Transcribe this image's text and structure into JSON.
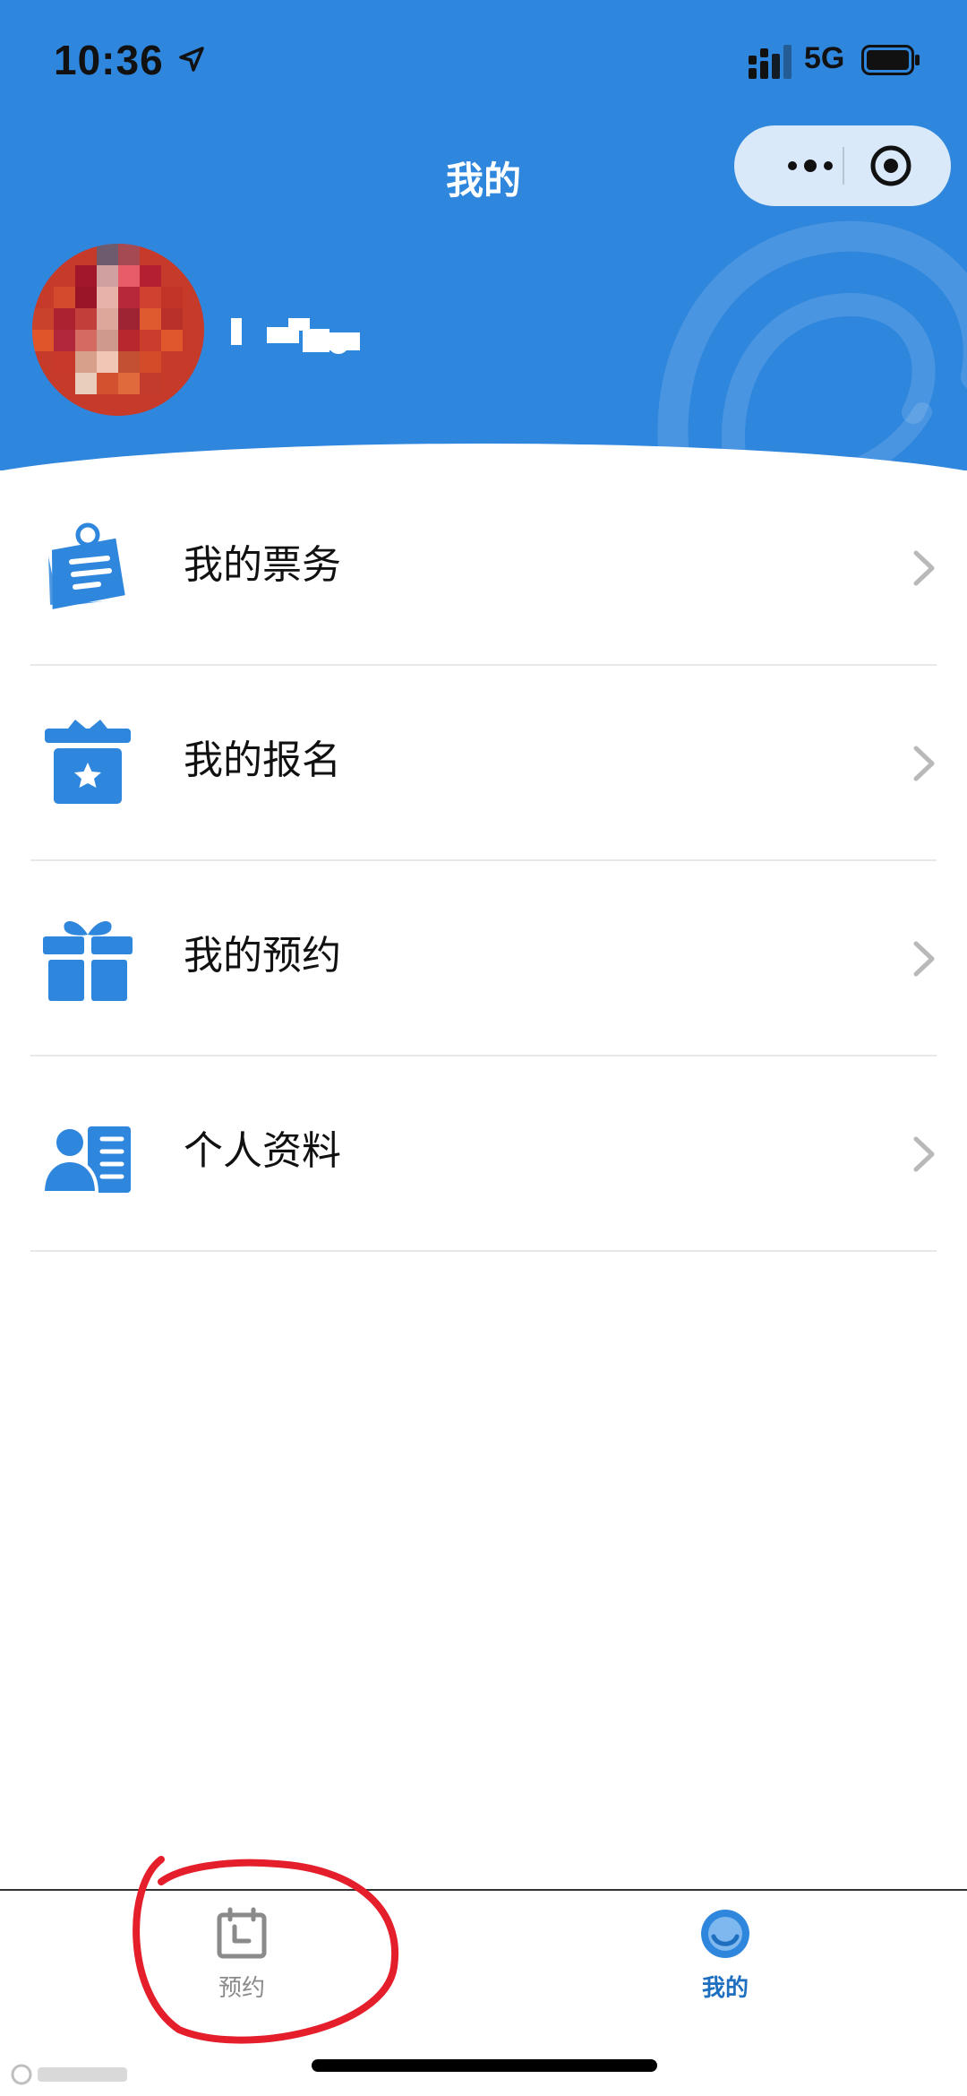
{
  "status_bar": {
    "time": "10:36",
    "network": "5G",
    "location_icon": "location-arrow-icon",
    "signal_icon": "signal-icon",
    "battery_icon": "battery-icon"
  },
  "header": {
    "title": "我的",
    "background_color": "#2f86dd",
    "more_icon": "more-dots-icon",
    "close_icon": "target-close-icon"
  },
  "profile": {
    "avatar_icon": "avatar-pixelated",
    "nickname_icon": "redacted-nickname"
  },
  "menu": {
    "items": [
      {
        "label": "我的票务",
        "icon": "ticket-clipboard-icon"
      },
      {
        "label": "我的报名",
        "icon": "gift-box-star-icon"
      },
      {
        "label": "我的预约",
        "icon": "gift-icon"
      },
      {
        "label": "个人资料",
        "icon": "profile-card-icon"
      }
    ],
    "chevron_icon": "chevron-right-icon",
    "accent_color": "#2f86dd"
  },
  "tabbar": {
    "tabs": [
      {
        "label": "预约",
        "icon": "calendar-icon",
        "active": false
      },
      {
        "label": "我的",
        "icon": "user-circle-icon",
        "active": true
      }
    ],
    "active_color": "#1e6fbf",
    "inactive_color": "#8a8a8a"
  }
}
